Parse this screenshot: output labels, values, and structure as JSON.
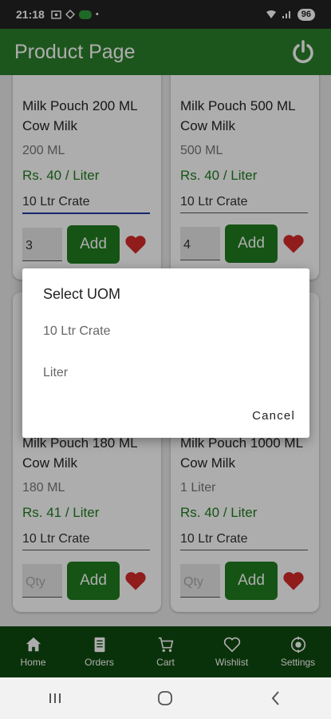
{
  "status_bar": {
    "time": "21:18",
    "battery": "96"
  },
  "app_bar": {
    "title": "Product Page",
    "power_icon": "power-icon"
  },
  "products": [
    {
      "name": "Milk Pouch 200 ML Cow Milk",
      "size": "200 ML",
      "price": "Rs. 40 / Liter",
      "uom": "10 Ltr Crate",
      "qty": "3",
      "add_label": "Add"
    },
    {
      "name": "Milk Pouch 500 ML Cow Milk",
      "size": "500 ML",
      "price": "Rs. 40 / Liter",
      "uom": "10 Ltr Crate",
      "qty": "4",
      "add_label": "Add"
    },
    {
      "name": "Milk Pouch 180 ML Cow Milk",
      "size": "180 ML",
      "price": "Rs. 41 / Liter",
      "uom": "10 Ltr Crate",
      "qty_placeholder": "Qty",
      "add_label": "Add"
    },
    {
      "name": "Milk Pouch 1000 ML Cow Milk",
      "size": "1 Liter",
      "price": "Rs. 40 / Liter",
      "uom": "10 Ltr Crate",
      "qty_placeholder": "Qty",
      "add_label": "Add"
    }
  ],
  "dialog": {
    "title": "Select UOM",
    "options": [
      "10 Ltr Crate",
      "Liter"
    ],
    "cancel_label": "Cancel"
  },
  "bottom_nav": [
    {
      "label": "Home",
      "icon": "home-icon"
    },
    {
      "label": "Orders",
      "icon": "orders-icon"
    },
    {
      "label": "Cart",
      "icon": "cart-icon"
    },
    {
      "label": "Wishlist",
      "icon": "heart-outline-icon"
    },
    {
      "label": "Settings",
      "icon": "settings-icon"
    }
  ],
  "colors": {
    "app_bar": "#2c7f2b",
    "accent_green": "#1f7d1f",
    "bottom_nav": "#0f4a10",
    "heart": "#d42a2a"
  }
}
